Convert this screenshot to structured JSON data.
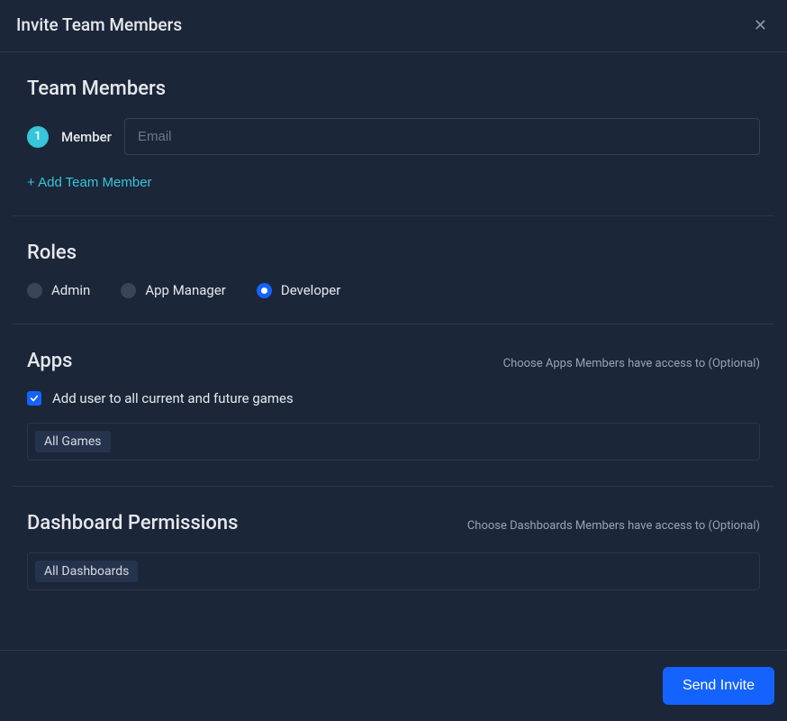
{
  "header": {
    "title": "Invite Team Members"
  },
  "team": {
    "section_title": "Team Members",
    "badge": "1",
    "member_label": "Member",
    "email_placeholder": "Email",
    "email_value": "",
    "add_link": "+ Add Team Member"
  },
  "roles": {
    "section_title": "Roles",
    "options": [
      {
        "label": "Admin",
        "checked": false
      },
      {
        "label": "App Manager",
        "checked": false
      },
      {
        "label": "Developer",
        "checked": true
      }
    ]
  },
  "apps": {
    "section_title": "Apps",
    "hint": "Choose Apps Members have access to (Optional)",
    "checkbox_label": "Add user to all current and future games",
    "checkbox_checked": true,
    "chip": "All Games"
  },
  "dash": {
    "section_title": "Dashboard Permissions",
    "hint": "Choose Dashboards Members have access to (Optional)",
    "chip": "All Dashboards"
  },
  "footer": {
    "send_label": "Send Invite"
  },
  "colors": {
    "accent_teal": "#36c5d9",
    "accent_blue": "#1463ff",
    "bg": "#1b2639"
  }
}
